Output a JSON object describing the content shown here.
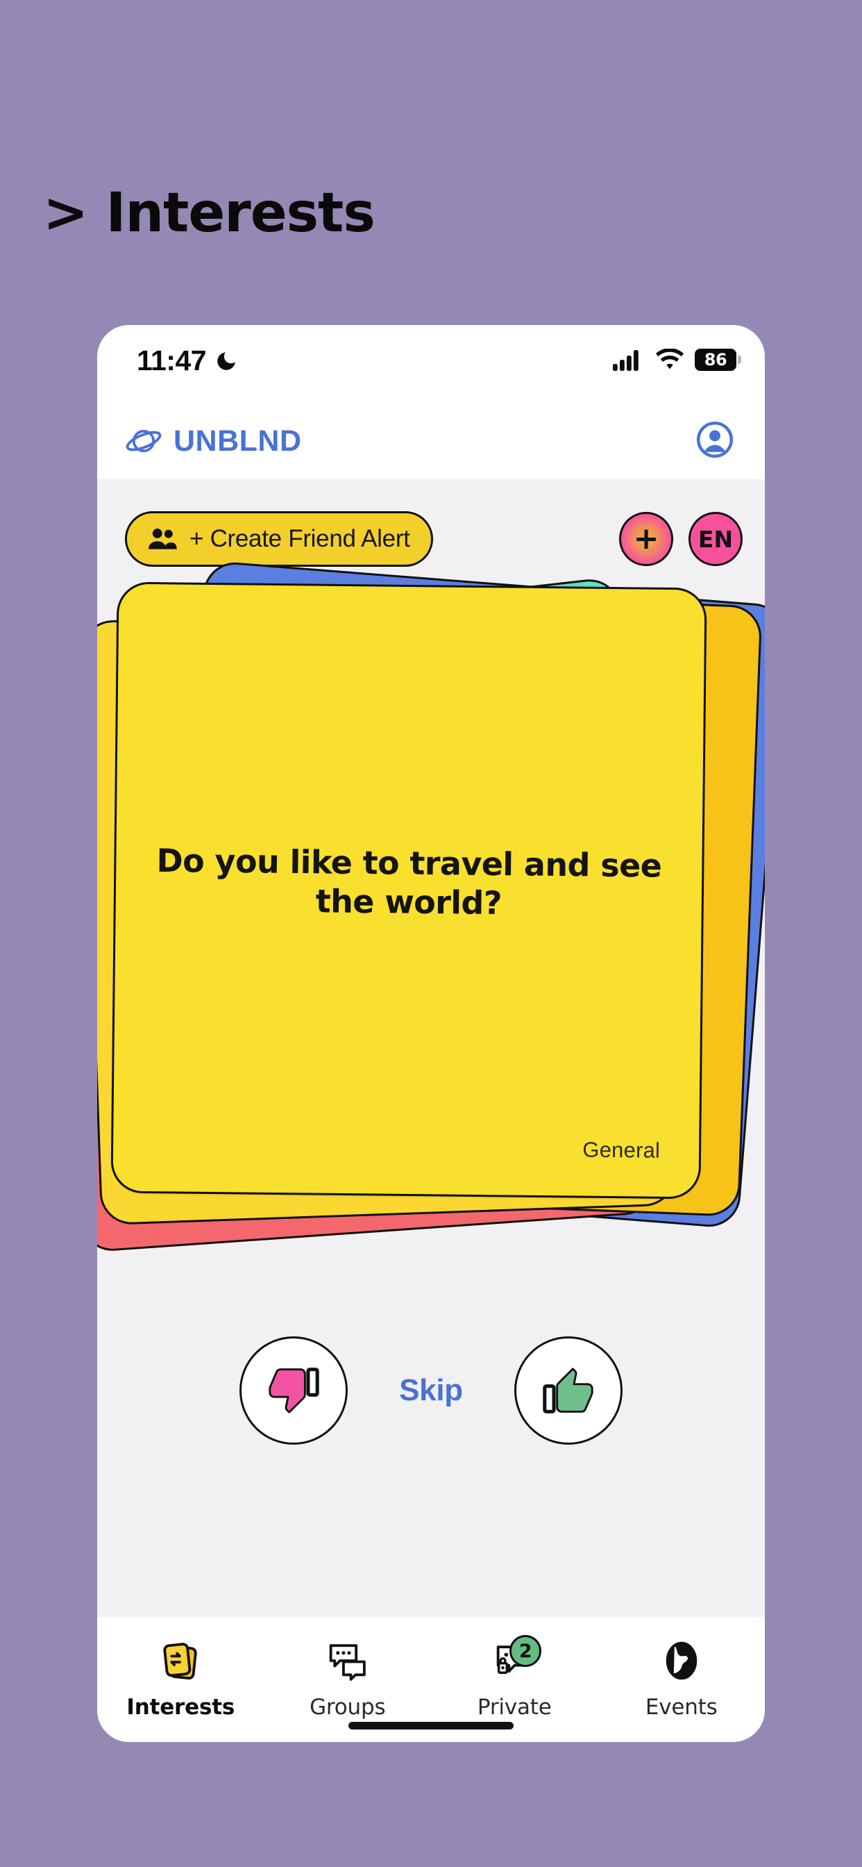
{
  "page": {
    "background_color": "#9688b4",
    "title": "> Interests"
  },
  "status_bar": {
    "time": "11:47",
    "dnd_icon": "crescent-moon-icon",
    "cellular_icon": "signal-bars-icon",
    "wifi_icon": "wifi-icon",
    "battery_level": "86"
  },
  "app_header": {
    "logo_icon": "planet-icon",
    "brand_name": "UNBLND",
    "profile_icon": "account-circle-icon"
  },
  "actions": {
    "friend_alert_label": "+ Create Friend Alert",
    "friend_alert_icon": "people-icon",
    "friend_alert_color": "#f2cf2b",
    "add_button_label": "+",
    "language_button_label": "EN",
    "circle_button_color": "#f7519e"
  },
  "card_stack": {
    "front_card": {
      "question": "Do you like to travel and see the world?",
      "category": "General",
      "color": "#f9df2e"
    },
    "background_cards": [
      {
        "color": "#5ae0c8",
        "name": "teal"
      },
      {
        "color": "#5b7fe0",
        "name": "blue"
      },
      {
        "color": "#f4676c",
        "name": "red"
      },
      {
        "color": "#f7c319",
        "name": "gold"
      },
      {
        "color": "#fad731",
        "name": "yellow"
      }
    ]
  },
  "swipe_actions": {
    "dislike_icon": "thumbs-down-icon",
    "dislike_color": "#f254a3",
    "skip_label": "Skip",
    "skip_color": "#4a72d4",
    "like_icon": "thumbs-up-icon",
    "like_color": "#6fbf8b"
  },
  "bottom_nav": {
    "items": [
      {
        "label": "Interests",
        "icon": "cards-swap-icon",
        "active": true,
        "badge": ""
      },
      {
        "label": "Groups",
        "icon": "chat-bubbles-icon",
        "active": false,
        "badge": ""
      },
      {
        "label": "Private",
        "icon": "private-chat-icon",
        "active": false,
        "badge": "2"
      },
      {
        "label": "Events",
        "icon": "globe-icon",
        "active": false,
        "badge": ""
      }
    ]
  }
}
